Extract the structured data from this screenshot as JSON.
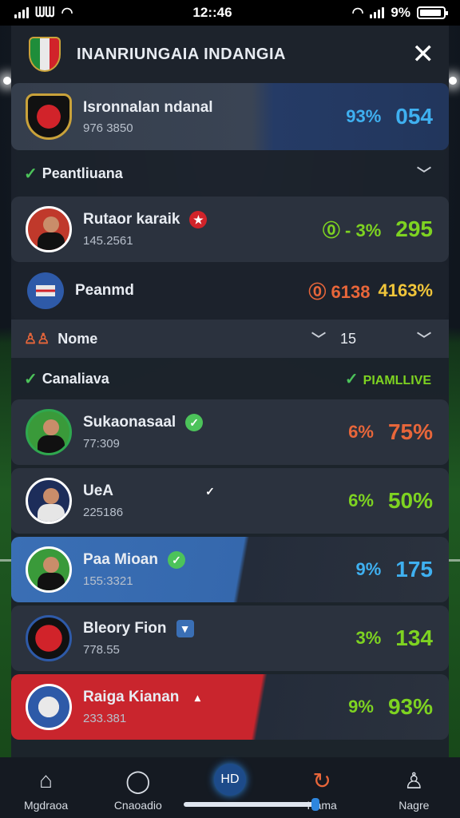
{
  "status_bar": {
    "time": "12::46",
    "carrier_glyph": "ᗯᗯ",
    "battery": "9%"
  },
  "header": {
    "title": "INANRIUNGAIA INDANGIA"
  },
  "top_team": {
    "name": "Isronnalan ndanal",
    "sub": "976 3850",
    "pct": "93%",
    "value": "054"
  },
  "section1": {
    "label": "Peantliuana"
  },
  "player1": {
    "name": "Rutaor karaik",
    "sub": "145.2561",
    "pct": "⓪ - 3%",
    "value": "295"
  },
  "row2": {
    "label": "Peanmd",
    "stat": "⓪ 6138",
    "value": "4163%"
  },
  "filter_row": {
    "label": "Nome",
    "count": "15"
  },
  "section2": {
    "label": "Canaliava",
    "right_label": "PIAMLLIVE"
  },
  "players": [
    {
      "name": "Sukaonasaal",
      "sub": "77:309",
      "pct": "6%",
      "value": "75%"
    },
    {
      "name": "UeA",
      "sub": "225186",
      "pct": "6%",
      "value": "50%"
    },
    {
      "name": "Paa Mioan",
      "sub": "155:3321",
      "pct": "9%",
      "value": "175"
    },
    {
      "name": "Bleory Fion",
      "sub": "778.55",
      "pct": "3%",
      "value": "134"
    },
    {
      "name": "Raiga Kianan",
      "sub": "233.381",
      "pct": "9%",
      "value": "93%"
    }
  ],
  "bottom_nav": [
    {
      "label": "Mgdraoa",
      "icon": "home-icon"
    },
    {
      "label": "Cnaoadio",
      "icon": "ball-icon"
    },
    {
      "label": "HD",
      "icon": "hd-icon"
    },
    {
      "label": "Hama",
      "icon": "refresh-icon"
    },
    {
      "label": "Nagre",
      "icon": "profile-icon"
    }
  ],
  "colors": {
    "accent_blue": "#3fb0f0",
    "green": "#7ed321",
    "orange": "#e8663a",
    "red_card": "#c9252d"
  }
}
